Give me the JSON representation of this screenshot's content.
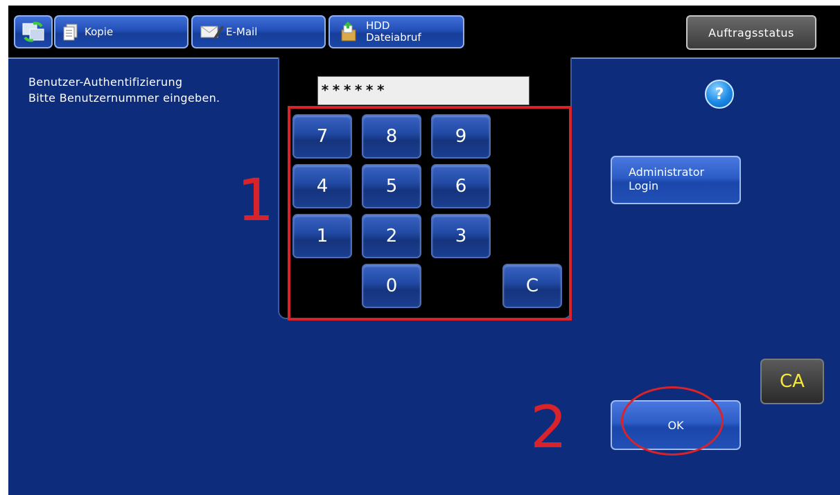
{
  "topbar": {
    "tabs": [
      {
        "label": "Kopie",
        "icon": "copy-document-icon"
      },
      {
        "label": "E-Mail",
        "icon": "email-pen-icon"
      },
      {
        "label_line1": "HDD",
        "label_line2": "Dateiabruf",
        "icon": "document-retrieval-icon"
      }
    ],
    "home_icon": "mode-switch-icon",
    "job_status_label": "Auftragsstatus"
  },
  "prompt": {
    "line1": "Benutzer-Authentifizierung",
    "line2": "Bitte Benutzernummer eingeben."
  },
  "pin": {
    "masked_value": "******"
  },
  "keypad": {
    "keys": [
      "7",
      "8",
      "9",
      "4",
      "5",
      "6",
      "1",
      "2",
      "3",
      "0",
      "C"
    ]
  },
  "annotations": {
    "step1": "1",
    "step2": "2"
  },
  "buttons": {
    "help": "?",
    "admin_line1": "Administrator",
    "admin_line2": "Login",
    "ok": "OK",
    "clear_all": "CA"
  },
  "colors": {
    "panel_bg": "#0e2c7c",
    "annotation_red": "#d8232a",
    "ca_text": "#f6e83a"
  }
}
